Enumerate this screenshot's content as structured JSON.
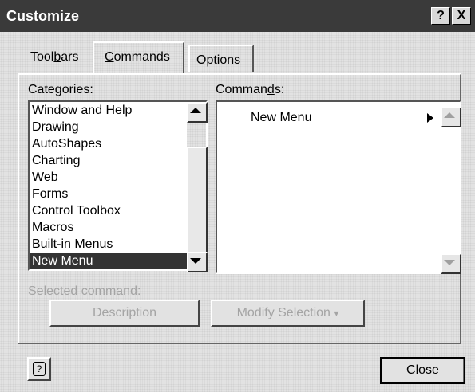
{
  "window": {
    "title": "Customize",
    "help_button": "?",
    "close_button": "X"
  },
  "tabs": [
    {
      "label_pre": "Tool",
      "label_ul": "b",
      "label_post": "ars"
    },
    {
      "label_pre": "",
      "label_ul": "C",
      "label_post": "ommands"
    },
    {
      "label_pre": "",
      "label_ul": "O",
      "label_post": "ptions"
    }
  ],
  "categories": {
    "label_pre": "Cate",
    "label_ul": "g",
    "label_post": "ories:",
    "items": [
      "Window and Help",
      "Drawing",
      "AutoShapes",
      "Charting",
      "Web",
      "Forms",
      "Control Toolbox",
      "Macros",
      "Built-in Menus",
      "New Menu"
    ],
    "selected": "New Menu"
  },
  "commands": {
    "label_pre": "Comman",
    "label_ul": "d",
    "label_post": "s:",
    "items": [
      "New Menu"
    ]
  },
  "selected_command": {
    "label": "Selected command:",
    "description_button": "Description",
    "modify_button": "Modify Selection",
    "modify_arrow": "▾"
  },
  "footer": {
    "help_icon": "?",
    "close_label": "Close"
  }
}
